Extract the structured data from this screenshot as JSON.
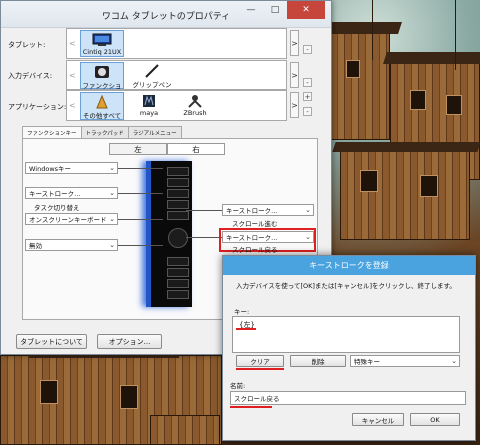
{
  "window": {
    "title": "ワコム タブレットのプロパティ",
    "minimize": "—",
    "maximize": "□",
    "close": "✕"
  },
  "rows": {
    "tablet_label": "タブレット:",
    "device_label": "入力デバイス:",
    "app_label": "アプリケーション:",
    "tablets": [
      "Cintiq 21UX"
    ],
    "devices": [
      "ファンクション",
      "グリップペン"
    ],
    "apps": [
      "その他すべて",
      "maya",
      "ZBrush"
    ],
    "left_arrow": "<",
    "right_arrow": ">",
    "plus": "+",
    "minus": "-"
  },
  "tabs": [
    "ファンクションキー",
    "トラックパッド",
    "ラジアルメニュー"
  ],
  "side": {
    "left": "左",
    "right": "右"
  },
  "left_keys": {
    "combo1": "Windowsキー",
    "combo2": "キーストローク...",
    "combo2_sub": "タスク切り替え",
    "combo3": "オンスクリーンキーボード",
    "combo4": "無効"
  },
  "right_keys": {
    "combo1": "キーストローク...",
    "combo1_sub": "スクロール進む",
    "combo2": "キーストローク...",
    "combo2_sub": "スクロール戻る"
  },
  "bottom": {
    "about": "タブレットについて",
    "options": "オプション..."
  },
  "dialog": {
    "title": "キーストロークを登録",
    "instruction": "入力デバイスを使って[OK]または[キャンセル]をクリックし、終了します。",
    "key_label": "キー:",
    "key_value": "{左}",
    "clear": "クリア",
    "delete": "削除",
    "special": "特殊キー",
    "name_label": "名前:",
    "name_value": "スクロール戻る",
    "cancel": "キャンセル",
    "ok": "OK"
  },
  "colors": {
    "accent": "#4aa3df",
    "highlight": "#e02020",
    "tablet_glow": "#2255c8"
  }
}
